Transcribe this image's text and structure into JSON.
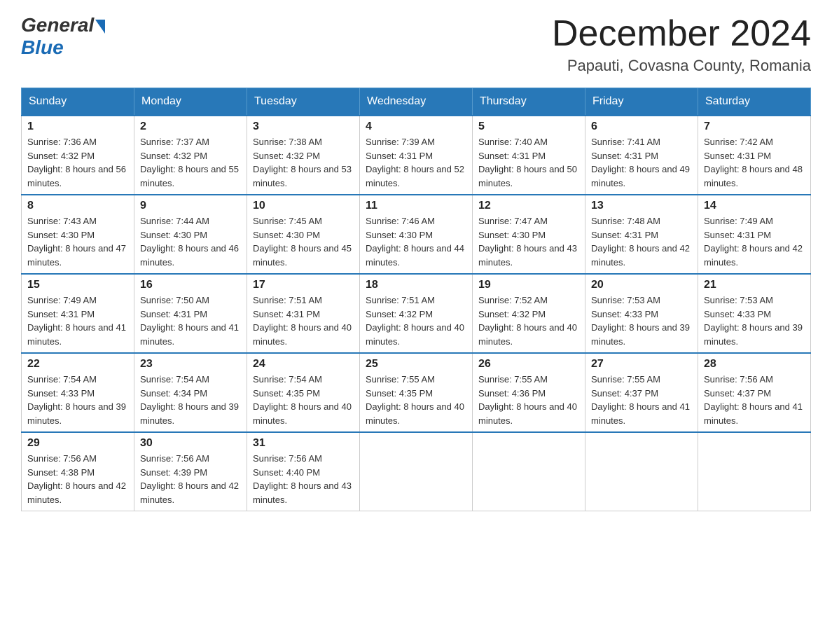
{
  "header": {
    "logo_general": "General",
    "logo_blue": "Blue",
    "month_title": "December 2024",
    "location": "Papauti, Covasna County, Romania"
  },
  "days_of_week": [
    "Sunday",
    "Monday",
    "Tuesday",
    "Wednesday",
    "Thursday",
    "Friday",
    "Saturday"
  ],
  "weeks": [
    [
      {
        "day": "1",
        "sunrise": "7:36 AM",
        "sunset": "4:32 PM",
        "daylight": "8 hours and 56 minutes."
      },
      {
        "day": "2",
        "sunrise": "7:37 AM",
        "sunset": "4:32 PM",
        "daylight": "8 hours and 55 minutes."
      },
      {
        "day": "3",
        "sunrise": "7:38 AM",
        "sunset": "4:32 PM",
        "daylight": "8 hours and 53 minutes."
      },
      {
        "day": "4",
        "sunrise": "7:39 AM",
        "sunset": "4:31 PM",
        "daylight": "8 hours and 52 minutes."
      },
      {
        "day": "5",
        "sunrise": "7:40 AM",
        "sunset": "4:31 PM",
        "daylight": "8 hours and 50 minutes."
      },
      {
        "day": "6",
        "sunrise": "7:41 AM",
        "sunset": "4:31 PM",
        "daylight": "8 hours and 49 minutes."
      },
      {
        "day": "7",
        "sunrise": "7:42 AM",
        "sunset": "4:31 PM",
        "daylight": "8 hours and 48 minutes."
      }
    ],
    [
      {
        "day": "8",
        "sunrise": "7:43 AM",
        "sunset": "4:30 PM",
        "daylight": "8 hours and 47 minutes."
      },
      {
        "day": "9",
        "sunrise": "7:44 AM",
        "sunset": "4:30 PM",
        "daylight": "8 hours and 46 minutes."
      },
      {
        "day": "10",
        "sunrise": "7:45 AM",
        "sunset": "4:30 PM",
        "daylight": "8 hours and 45 minutes."
      },
      {
        "day": "11",
        "sunrise": "7:46 AM",
        "sunset": "4:30 PM",
        "daylight": "8 hours and 44 minutes."
      },
      {
        "day": "12",
        "sunrise": "7:47 AM",
        "sunset": "4:30 PM",
        "daylight": "8 hours and 43 minutes."
      },
      {
        "day": "13",
        "sunrise": "7:48 AM",
        "sunset": "4:31 PM",
        "daylight": "8 hours and 42 minutes."
      },
      {
        "day": "14",
        "sunrise": "7:49 AM",
        "sunset": "4:31 PM",
        "daylight": "8 hours and 42 minutes."
      }
    ],
    [
      {
        "day": "15",
        "sunrise": "7:49 AM",
        "sunset": "4:31 PM",
        "daylight": "8 hours and 41 minutes."
      },
      {
        "day": "16",
        "sunrise": "7:50 AM",
        "sunset": "4:31 PM",
        "daylight": "8 hours and 41 minutes."
      },
      {
        "day": "17",
        "sunrise": "7:51 AM",
        "sunset": "4:31 PM",
        "daylight": "8 hours and 40 minutes."
      },
      {
        "day": "18",
        "sunrise": "7:51 AM",
        "sunset": "4:32 PM",
        "daylight": "8 hours and 40 minutes."
      },
      {
        "day": "19",
        "sunrise": "7:52 AM",
        "sunset": "4:32 PM",
        "daylight": "8 hours and 40 minutes."
      },
      {
        "day": "20",
        "sunrise": "7:53 AM",
        "sunset": "4:33 PM",
        "daylight": "8 hours and 39 minutes."
      },
      {
        "day": "21",
        "sunrise": "7:53 AM",
        "sunset": "4:33 PM",
        "daylight": "8 hours and 39 minutes."
      }
    ],
    [
      {
        "day": "22",
        "sunrise": "7:54 AM",
        "sunset": "4:33 PM",
        "daylight": "8 hours and 39 minutes."
      },
      {
        "day": "23",
        "sunrise": "7:54 AM",
        "sunset": "4:34 PM",
        "daylight": "8 hours and 39 minutes."
      },
      {
        "day": "24",
        "sunrise": "7:54 AM",
        "sunset": "4:35 PM",
        "daylight": "8 hours and 40 minutes."
      },
      {
        "day": "25",
        "sunrise": "7:55 AM",
        "sunset": "4:35 PM",
        "daylight": "8 hours and 40 minutes."
      },
      {
        "day": "26",
        "sunrise": "7:55 AM",
        "sunset": "4:36 PM",
        "daylight": "8 hours and 40 minutes."
      },
      {
        "day": "27",
        "sunrise": "7:55 AM",
        "sunset": "4:37 PM",
        "daylight": "8 hours and 41 minutes."
      },
      {
        "day": "28",
        "sunrise": "7:56 AM",
        "sunset": "4:37 PM",
        "daylight": "8 hours and 41 minutes."
      }
    ],
    [
      {
        "day": "29",
        "sunrise": "7:56 AM",
        "sunset": "4:38 PM",
        "daylight": "8 hours and 42 minutes."
      },
      {
        "day": "30",
        "sunrise": "7:56 AM",
        "sunset": "4:39 PM",
        "daylight": "8 hours and 42 minutes."
      },
      {
        "day": "31",
        "sunrise": "7:56 AM",
        "sunset": "4:40 PM",
        "daylight": "8 hours and 43 minutes."
      },
      null,
      null,
      null,
      null
    ]
  ]
}
